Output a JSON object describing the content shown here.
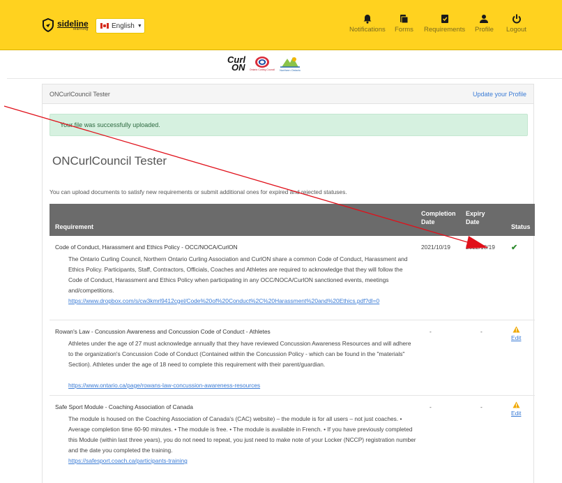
{
  "header": {
    "logo_text": "sideline",
    "logo_sub": "learning",
    "language": "English",
    "nav": [
      {
        "label": "Notifications",
        "icon": "bell-icon"
      },
      {
        "label": "Forms",
        "icon": "clipboard-icon"
      },
      {
        "label": "Requirements",
        "icon": "checklist-icon"
      },
      {
        "label": "Profile",
        "icon": "user-icon"
      },
      {
        "label": "Logout",
        "icon": "power-icon"
      }
    ]
  },
  "sponsors": {
    "curlon_top": "Curl",
    "curlon_bottom": "ON",
    "occ": "Ontario Curling Council",
    "noca": "Northern Ontario"
  },
  "card": {
    "header_name": "ONCurlCouncil Tester",
    "update_link": "Update your Profile",
    "alert": "Your file was successfully uploaded.",
    "title": "ONCurlCouncil Tester",
    "intro": "You can upload documents to satisfy new requirements or submit additional ones for expired and rejected statuses."
  },
  "table": {
    "headers": {
      "requirement": "Requirement",
      "completion_1": "Completion",
      "completion_2": "Date",
      "expiry_1": "Expiry",
      "expiry_2": "Date",
      "status": "Status"
    },
    "rows": [
      {
        "name": "Code of Conduct, Harassment and Ethics Policy - OCC/NOCA/CurlON",
        "desc": "The Ontario Curling Council, Northern Ontario Curling Association and CurlON share a common Code of Conduct, Harassment and Ethics Policy. Participants, Staff, Contractors, Officials, Coaches and Athletes are required to acknowledge that they will follow the Code of Conduct, Harassment and Ethics Policy when participating in any OCC/NOCA/CurlON sanctioned events, meetings and/competitions.",
        "link": "https://www.dropbox.com/s/cw3kmrl9412cgel/Code%20of%20Conduct%2C%20Harassment%20and%20Ethics.pdf?dl=0",
        "completion": "2021/10/19",
        "expiry": "2022/10/19",
        "status": "complete"
      },
      {
        "name": "Rowan's Law - Concussion Awareness and Concussion Code of Conduct - Athletes",
        "desc": "Athletes under the age of 27 must acknowledge annually that they have reviewed Concussion Awareness Resources and will adhere to the organization's Concussion Code of Conduct (Contained within the Concussion Policy - which can be found in the \"materials\" Section). Athletes under the age of 18 need to complete this requirement with their parent/guardian.",
        "link": "https://www.ontario.ca/page/rowans-law-concussion-awareness-resources",
        "completion": "-",
        "expiry": "-",
        "status": "warning",
        "action": "Edit"
      },
      {
        "name": "Safe Sport Module - Coaching Association of Canada",
        "desc": "The module is housed on the Coaching Association of Canada's (CAC) website) – the module is for all users – not just coaches. • Average completion time 60-90 minutes. • The module is free. • The module is available in French. • If you have previously completed this Module (within last three years), you do not need to repeat, you just need to make note of your Locker (NCCP) registration number and the date you completed the training.",
        "link": "https://safesport.coach.ca/participants-training",
        "completion": "-",
        "expiry": "-",
        "status": "warning",
        "action": "Edit"
      }
    ]
  },
  "colors": {
    "topbar": "#ffd21f",
    "table_header": "#6b6b6b",
    "alert_bg": "#d6f1e0",
    "link": "#3a7bd5",
    "check": "#2e8b2e",
    "warning": "#f0a800",
    "annotation": "#e0101a"
  }
}
